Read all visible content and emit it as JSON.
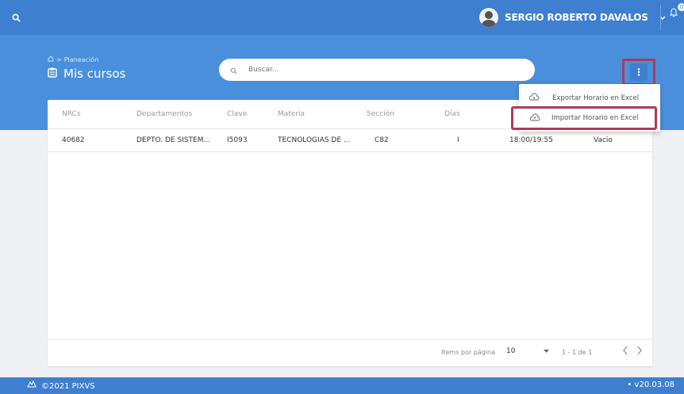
{
  "header": {
    "user_name": "SERGIO ROBERTO DAVALOS",
    "notification_count": "0"
  },
  "breadcrumb": {
    "items": [
      "Planeación"
    ]
  },
  "page": {
    "title": "Mis cursos"
  },
  "search": {
    "placeholder": "Buscar..."
  },
  "menu": {
    "items": [
      {
        "label": "Exportar Horario en Excel"
      },
      {
        "label": "Importar Horario en Excel"
      }
    ]
  },
  "table": {
    "columns": [
      "NRCs",
      "Departamentos",
      "Clave",
      "Materia",
      "Sección",
      "Días"
    ],
    "rows": [
      {
        "nrc": "40682",
        "departamento": "DEPTO. DE SISTEM...",
        "clave": "I5093",
        "materia": "TECNOLOGIAS DE ...",
        "seccion": "C82",
        "dias": "I",
        "horario": "18:00/19:55",
        "estado": "Vacio"
      }
    ]
  },
  "pagination": {
    "items_per_page_label": "Items por página",
    "items_per_page": "10",
    "range": "1 - 1 de 1"
  },
  "footer": {
    "copyright": "©2021 PIXVS",
    "version": "v20.03.08"
  },
  "colors": {
    "primary": "#3e7fd0",
    "hero": "#4a8fdc",
    "highlight": "#b03a5b"
  }
}
